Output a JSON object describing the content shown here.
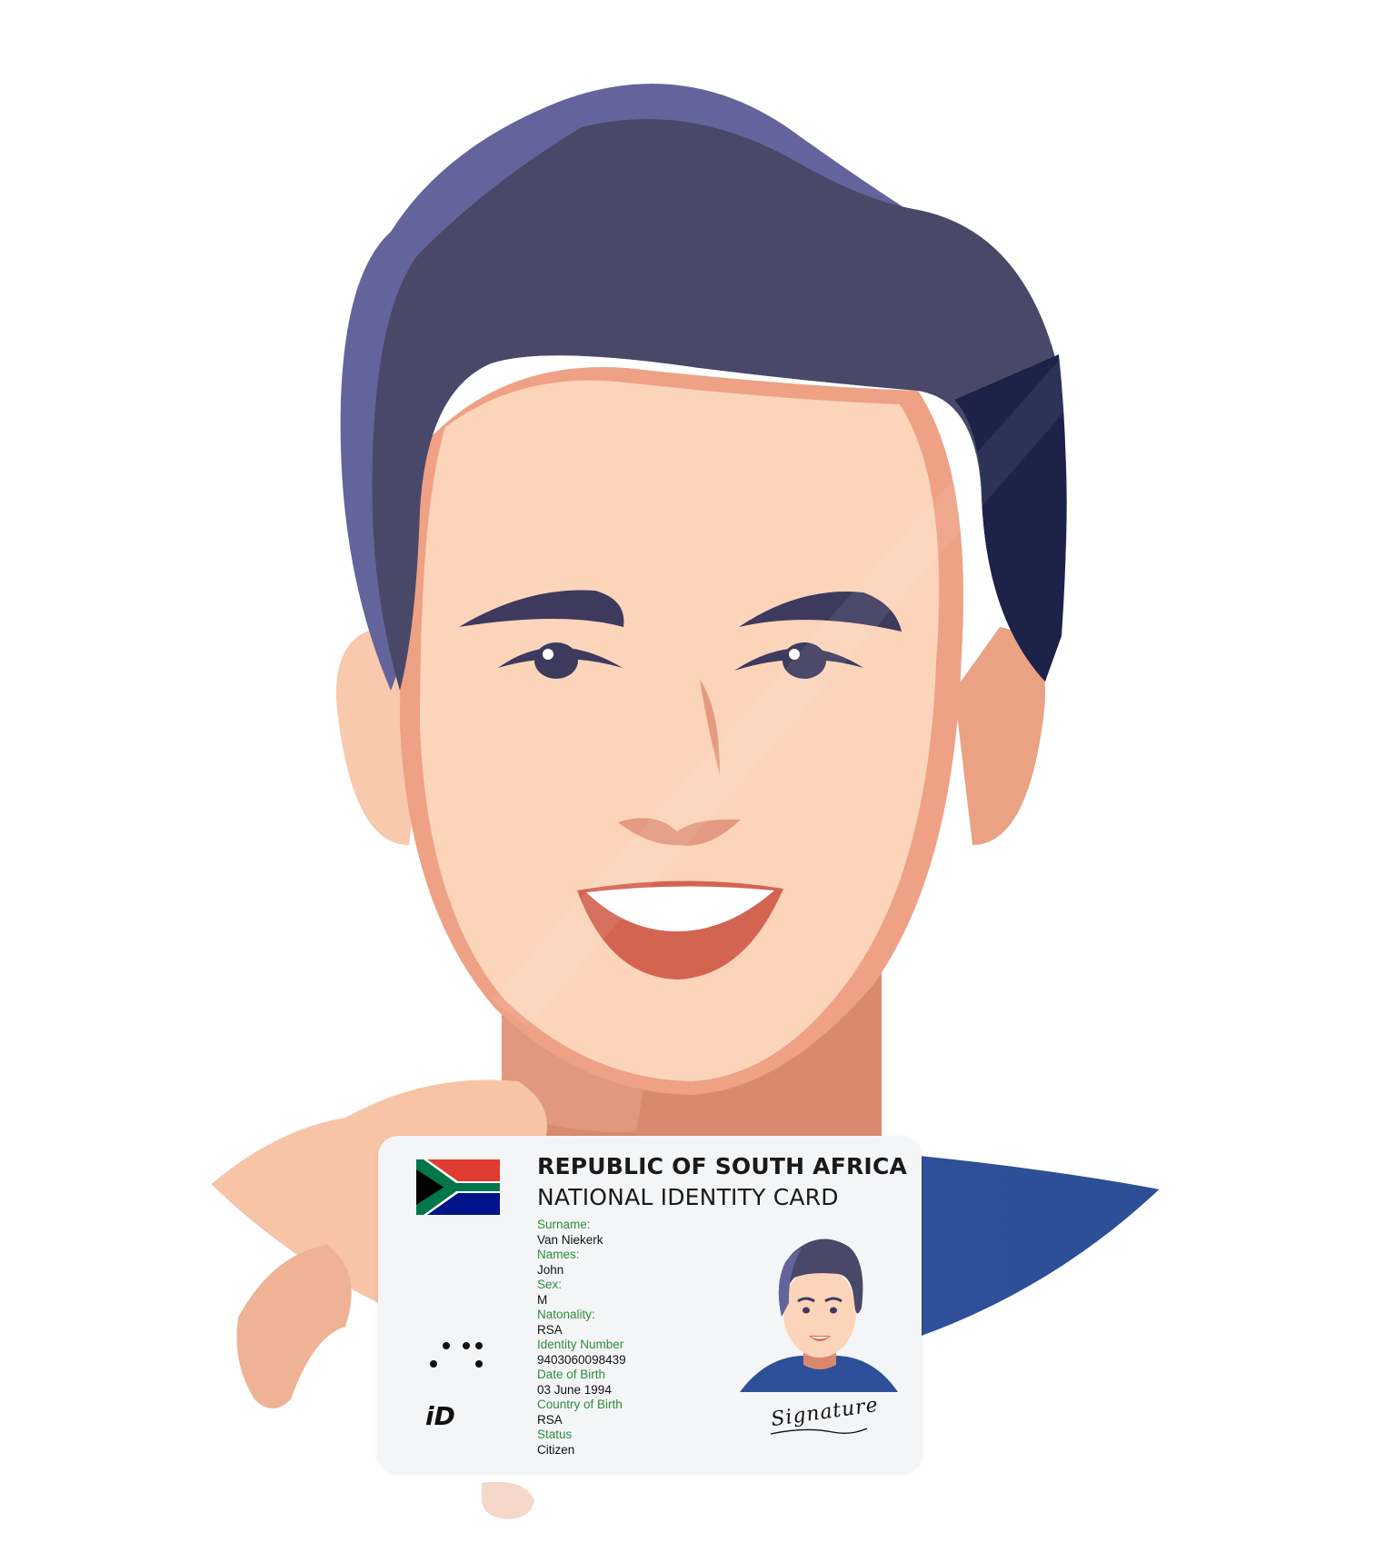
{
  "card": {
    "title_line1": "REPUBLIC OF SOUTH AFRICA",
    "title_line2": "NATIONAL IDENTITY CARD",
    "fields": [
      {
        "label": "Surname:",
        "value": "Van Niekerk"
      },
      {
        "label": "Names:",
        "value": "John"
      },
      {
        "label": "Sex:",
        "value": "M"
      },
      {
        "label": "Natonality:",
        "value": "RSA"
      },
      {
        "label": "Identity Number",
        "value": "9403060098439"
      },
      {
        "label": "Date of Birth",
        "value": "03 June 1994"
      },
      {
        "label": "Country of Birth",
        "value": "RSA"
      },
      {
        "label": "Status",
        "value": "Citizen"
      }
    ],
    "logo_text": "iD",
    "signature_text": "Signature"
  },
  "colors": {
    "hair": "#4a4868",
    "hair_light": "#64649c",
    "skin": "#fcd6bd",
    "skin_shadow": "#efa486",
    "shirt": "#2e509a",
    "label_green": "#2e8b3e"
  }
}
